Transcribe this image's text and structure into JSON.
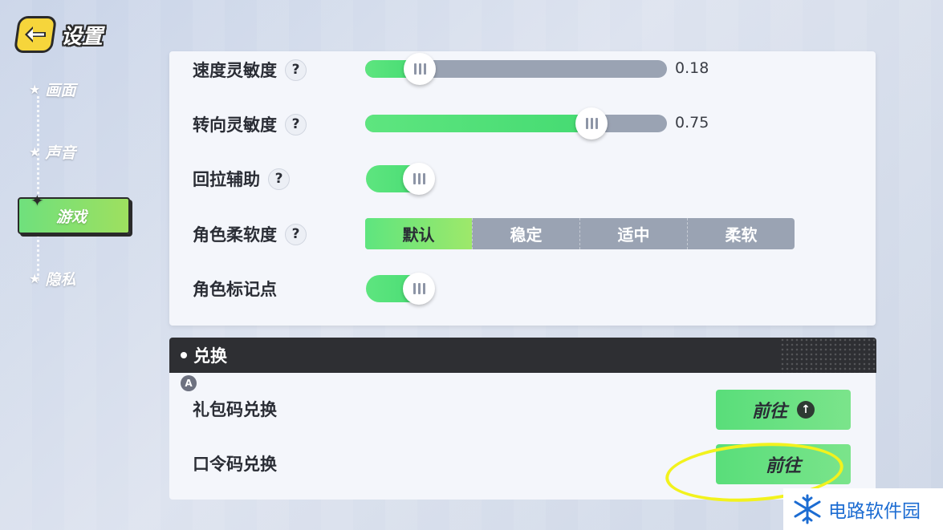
{
  "header": {
    "title": "设置",
    "back_icon": "back-arrow-icon"
  },
  "sidebar": {
    "items": [
      {
        "label": "画面",
        "active": false
      },
      {
        "label": "声音",
        "active": false
      },
      {
        "label": "游戏",
        "active": true
      },
      {
        "label": "隐私",
        "active": false
      }
    ]
  },
  "settings": {
    "speed_sensitivity": {
      "label": "速度灵敏度",
      "help": "?",
      "value_text": "0.18",
      "value": 0.18
    },
    "turn_sensitivity": {
      "label": "转向灵敏度",
      "help": "?",
      "value_text": "0.75",
      "value": 0.75
    },
    "pullback_assist": {
      "label": "回拉辅助",
      "help": "?",
      "enabled": true
    },
    "character_softness": {
      "label": "角色柔软度",
      "help": "?",
      "options": [
        "默认",
        "稳定",
        "适中",
        "柔软"
      ],
      "selected": "默认"
    },
    "character_marker": {
      "label": "角色标记点",
      "enabled": true
    }
  },
  "redeem_section": {
    "title": "兑换",
    "badge": "A",
    "rows": [
      {
        "label": "礼包码兑换",
        "button": "前往"
      },
      {
        "label": "口令码兑换",
        "button": "前往"
      }
    ]
  },
  "watermark": {
    "text": "电路软件园"
  },
  "colors": {
    "accent_green": "#5ee57f",
    "slider_track": "#9aa3b3",
    "panel_bg": "#f4f6fb",
    "header_dark": "#2e2f33",
    "highlight_yellow": "#f2f21d",
    "watermark_blue": "#1c6cd2"
  }
}
